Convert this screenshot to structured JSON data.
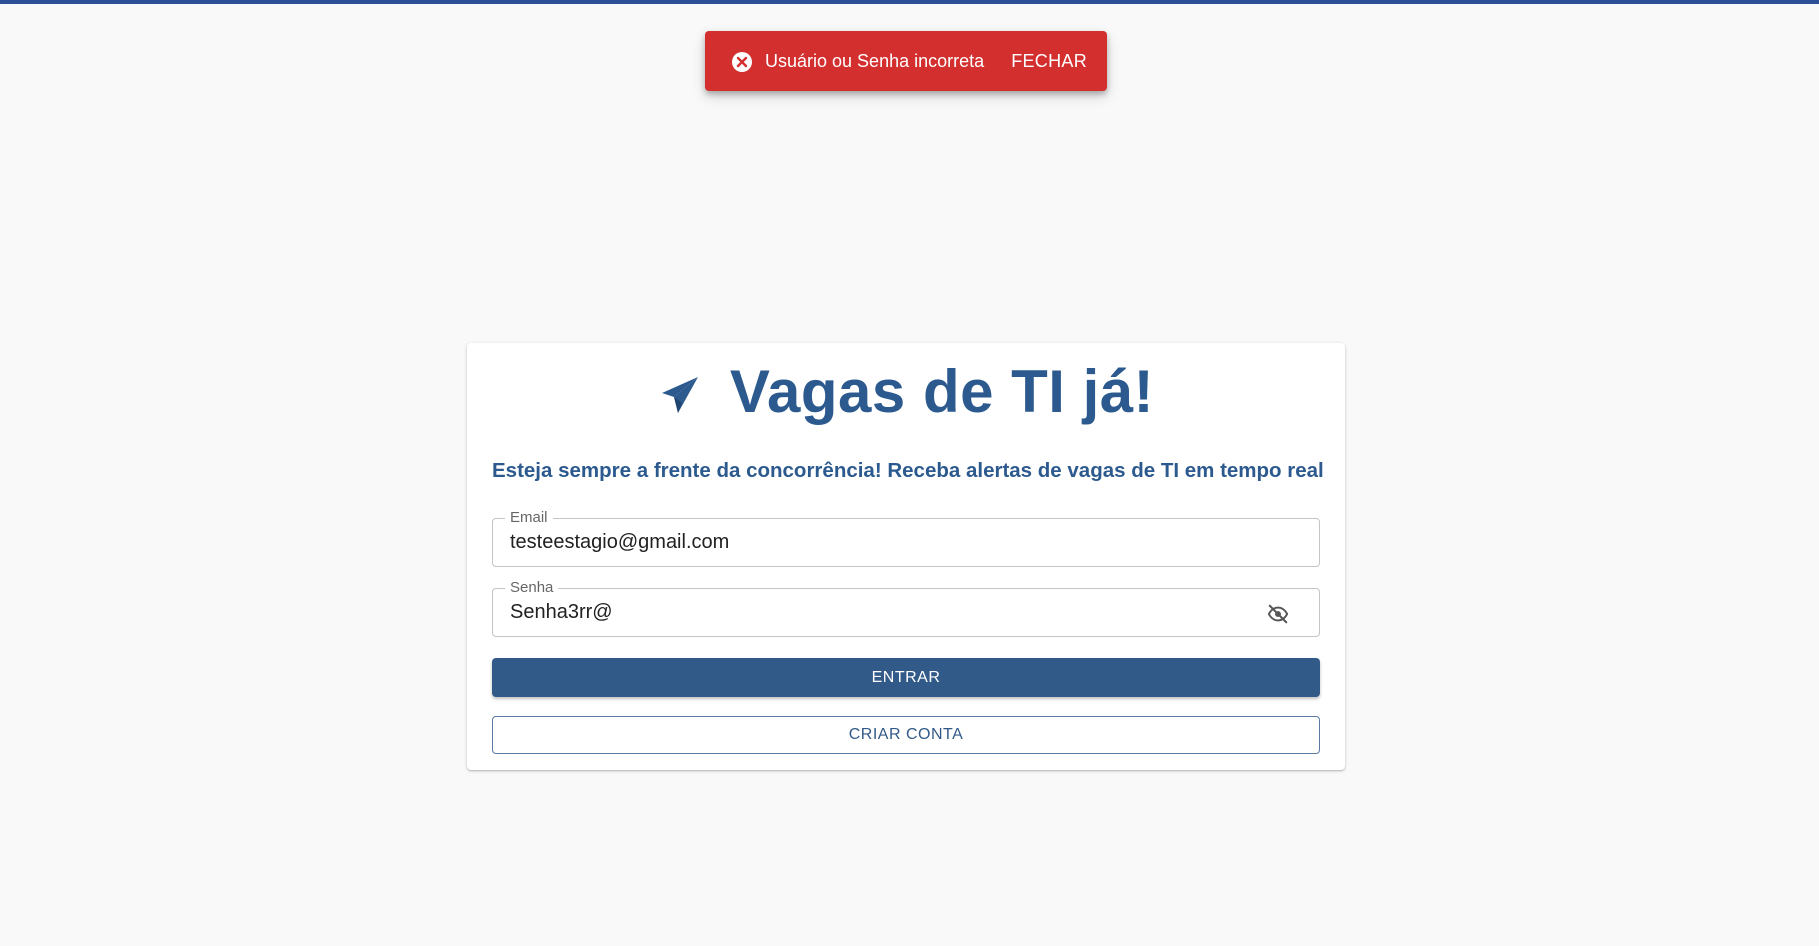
{
  "snackbar": {
    "icon": "error-circle-icon",
    "message": "Usuário ou Senha incorreta",
    "action_label": "FECHAR",
    "color": "#d32f2f"
  },
  "header": {
    "icon": "paper-plane-icon",
    "title": "Vagas de TI já!",
    "color": "#2c5a8e"
  },
  "subtitle": "Esteja sempre a frente da concorrência! Receba alertas de vagas de TI em tempo real",
  "form": {
    "email": {
      "label": "Email",
      "value": "testeestagio@gmail.com"
    },
    "senha": {
      "label": "Senha",
      "value": "Senha3rr@",
      "toggle_icon": "eye-off-icon"
    },
    "submit_label": "ENTRAR",
    "create_account_label": "CRIAR CONTA"
  },
  "colors": {
    "top_bar": "#2c4f95",
    "primary": "#325a89",
    "background": "#f9f9f9"
  }
}
